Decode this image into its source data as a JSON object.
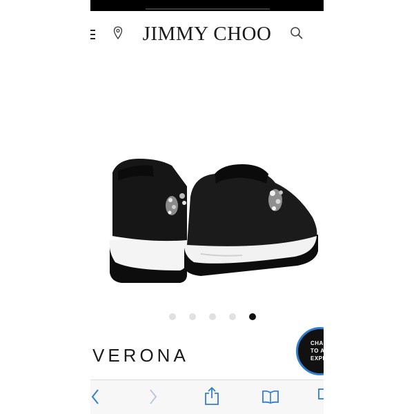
{
  "header": {
    "brand": "JIMMY CHOO",
    "icons": [
      "menu-icon",
      "location-icon",
      "search-icon"
    ]
  },
  "carousel": {
    "slide_count": 5,
    "active_index": 4
  },
  "product": {
    "name": "VERONA"
  },
  "chat": {
    "line1": "CHA",
    "line2": "TO A",
    "line3": "EXPE"
  },
  "browser_toolbar": {
    "icons": [
      "back-icon",
      "forward-icon",
      "share-icon",
      "bookmarks-icon",
      "tabs-icon"
    ]
  },
  "colors": {
    "accent_ring": "#2f7fd0",
    "text": "#1a1a1a"
  }
}
